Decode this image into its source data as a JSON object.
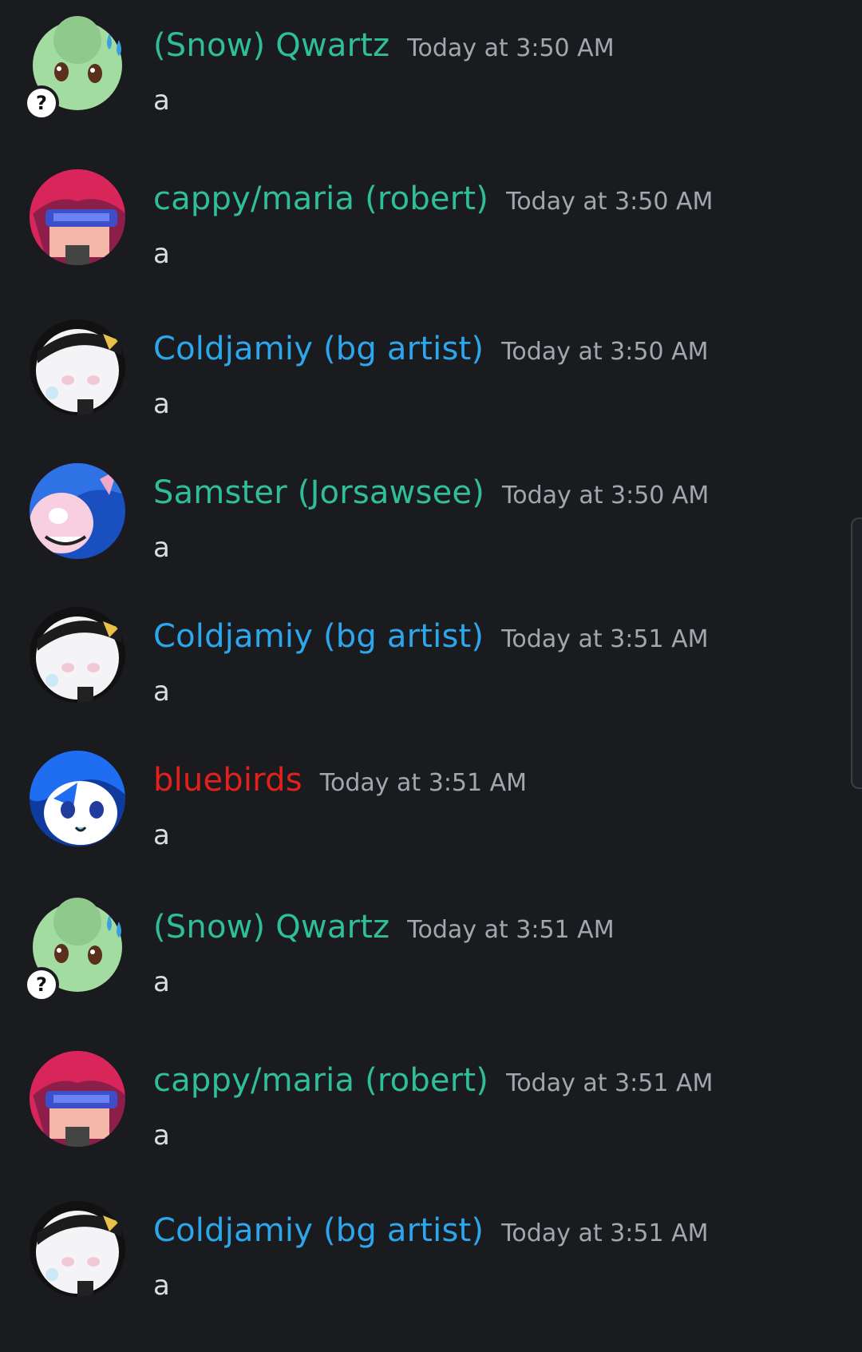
{
  "colors": {
    "background": "#1a1b1f",
    "timestamp": "#a3a6ad",
    "message_text": "#dcdde1",
    "username_teal": "#2fbf98",
    "username_blue": "#2da6ec",
    "username_red": "#e3201b"
  },
  "messages": [
    {
      "username": "(Snow) Qwartz",
      "timestamp": "Today at 3:50 AM",
      "content": "a",
      "name_color": "#2fbf98",
      "avatar": "qwartz",
      "badge": "?"
    },
    {
      "username": "cappy/maria (robert)",
      "timestamp": "Today at 3:50 AM",
      "content": "a",
      "name_color": "#2fbf98",
      "avatar": "cappy"
    },
    {
      "username": "Coldjamiy (bg artist)",
      "timestamp": "Today at 3:50 AM",
      "content": "a",
      "name_color": "#2da6ec",
      "avatar": "coldjamiy"
    },
    {
      "username": "Samster (Jorsawsee)",
      "timestamp": "Today at 3:50 AM",
      "content": "a",
      "name_color": "#2fbf98",
      "avatar": "samster"
    },
    {
      "username": "Coldjamiy (bg artist)",
      "timestamp": "Today at 3:51 AM",
      "content": "a",
      "name_color": "#2da6ec",
      "avatar": "coldjamiy"
    },
    {
      "username": "bluebirds",
      "timestamp": "Today at 3:51 AM",
      "content": "a",
      "name_color": "#e3201b",
      "avatar": "bluebirds"
    },
    {
      "username": "(Snow) Qwartz",
      "timestamp": "Today at 3:51 AM",
      "content": "a",
      "name_color": "#2fbf98",
      "avatar": "qwartz",
      "badge": "?"
    },
    {
      "username": "cappy/maria (robert)",
      "timestamp": "Today at 3:51 AM",
      "content": "a",
      "name_color": "#2fbf98",
      "avatar": "cappy"
    },
    {
      "username": "Coldjamiy (bg artist)",
      "timestamp": "Today at 3:51 AM",
      "content": "a",
      "name_color": "#2da6ec",
      "avatar": "coldjamiy"
    }
  ]
}
